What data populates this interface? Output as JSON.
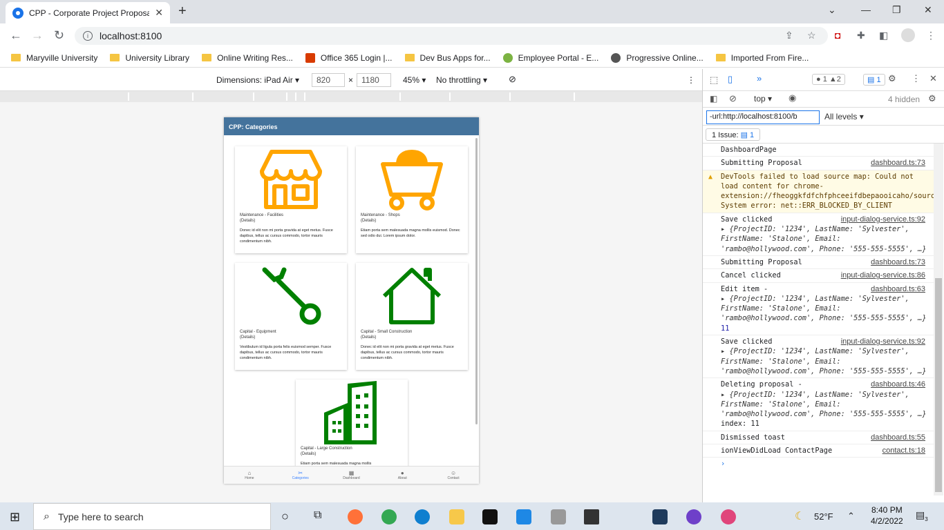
{
  "browser": {
    "tab_title": "CPP - Corporate Project Proposal",
    "url": "localhost:8100",
    "bookmarks": [
      "Maryville University",
      "University Library",
      "Online Writing Res...",
      "Office 365 Login |...",
      "Dev Bus Apps for...",
      "Employee Portal - E...",
      "Progressive Online...",
      "Imported From Fire..."
    ]
  },
  "device_toolbar": {
    "dimensions_label": "Dimensions: iPad Air",
    "width": "820",
    "times": "×",
    "height": "1180",
    "zoom": "45%",
    "throttling": "No throttling"
  },
  "app": {
    "header": "CPP: Categories",
    "cards": [
      {
        "title": "Maintenance - Facilities",
        "details": "(Details)",
        "desc": "Donec id elit non mi porta gravida at eget metus. Fusce dapibus, tellus ac cursus commodo, tortor mauris condimentum nibh.",
        "icon": "storefront-icon",
        "color": "#ffa500"
      },
      {
        "title": "Maintenance - Shops",
        "details": "(Details)",
        "desc": "Etiam porta sem malesuada magna mollis euismod. Donec sed odio dui. Lorem ipsum dolor.",
        "icon": "cart-icon",
        "color": "#ffa500"
      },
      {
        "title": "Capital - Equipment",
        "details": "(Details)",
        "desc": "Vestibulum id ligula porta felis euismod semper. Fusce dapibus, tellus ac cursus commodo, tortor mauris condimentum nibh.",
        "icon": "wrench-icon",
        "color": "#008000"
      },
      {
        "title": "Capital - Small Construction",
        "details": "(Details)",
        "desc": "Donec id elit non mi porta gravida at eget metus. Fusce dapibus, tellus ac cursus commodo, tortor mauris condimentum nibh.",
        "icon": "house-icon",
        "color": "#008000"
      },
      {
        "title": "Capital - Large Construction",
        "details": "(Details)",
        "desc": "Etiam porta sem malesuada magna mollis",
        "icon": "building-icon",
        "color": "#008000"
      }
    ],
    "tabs": [
      {
        "label": "Home",
        "icon": "home-icon"
      },
      {
        "label": "Categories",
        "icon": "tools-icon",
        "selected": true
      },
      {
        "label": "Dashboard",
        "icon": "grid-icon"
      },
      {
        "label": "About",
        "icon": "info-icon"
      },
      {
        "label": "Contact",
        "icon": "people-icon"
      }
    ]
  },
  "devtools": {
    "errors": "1",
    "warnings": "2",
    "messages": "1",
    "context": "top",
    "hidden": "4 hidden",
    "filter": "-url:http://localhost:8100/b",
    "levels": "All levels",
    "issues": "1 Issue:",
    "issues_count": "1",
    "logs": [
      {
        "text": "DashboardPage",
        "src": ""
      },
      {
        "text": "Submitting Proposal",
        "src": "dashboard.ts:73"
      },
      {
        "text": "DevTools failed to load source map: Could not load content for chrome-extension://fheoggkfdfchfphceeifdbepaooicaho/sourceMap/chrome/scripts/iframe_form_detection.map: System error: net::ERR_BLOCKED_BY_CLIENT",
        "src": "",
        "warn": true
      },
      {
        "text": "Save clicked",
        "src": "input-dialog-service.ts:92",
        "obj": "{ProjectID: '1234', LastName: 'Sylvester', FirstName: 'Stalone', Email: 'rambo@hollywood.com', Phone: '555-555-5555', …}"
      },
      {
        "text": "Submitting Proposal",
        "src": "dashboard.ts:73"
      },
      {
        "text": "Cancel clicked",
        "src": "input-dialog-service.ts:86"
      },
      {
        "text": "Edit item -",
        "src": "dashboard.ts:63",
        "obj": "{ProjectID: '1234', LastName: 'Sylvester', FirstName: 'Stalone', Email: 'rambo@hollywood.com', Phone: '555-555-5555', …}",
        "extra": "11"
      },
      {
        "text": "Save clicked",
        "src": "input-dialog-service.ts:92",
        "obj": "{ProjectID: '1234', LastName: 'Sylvester', FirstName: 'Stalone', Email: 'rambo@hollywood.com', Phone: '555-555-5555', …}"
      },
      {
        "text": "Deleting proposal -",
        "src": "dashboard.ts:46",
        "obj": "{ProjectID: '1234', LastName: 'Sylvester', FirstName: 'Stalone', Email: 'rambo@hollywood.com', Phone: '555-555-5555', …}",
        "extra": "index:  11"
      },
      {
        "text": "Dismissed toast",
        "src": "dashboard.ts:55"
      },
      {
        "text": "ionViewDidLoad ContactPage",
        "src": "contact.ts:18"
      }
    ]
  },
  "taskbar": {
    "search_placeholder": "Type here to search",
    "weather": "52°F",
    "time": "8:40 PM",
    "date": "4/2/2022",
    "notifications": "3"
  }
}
